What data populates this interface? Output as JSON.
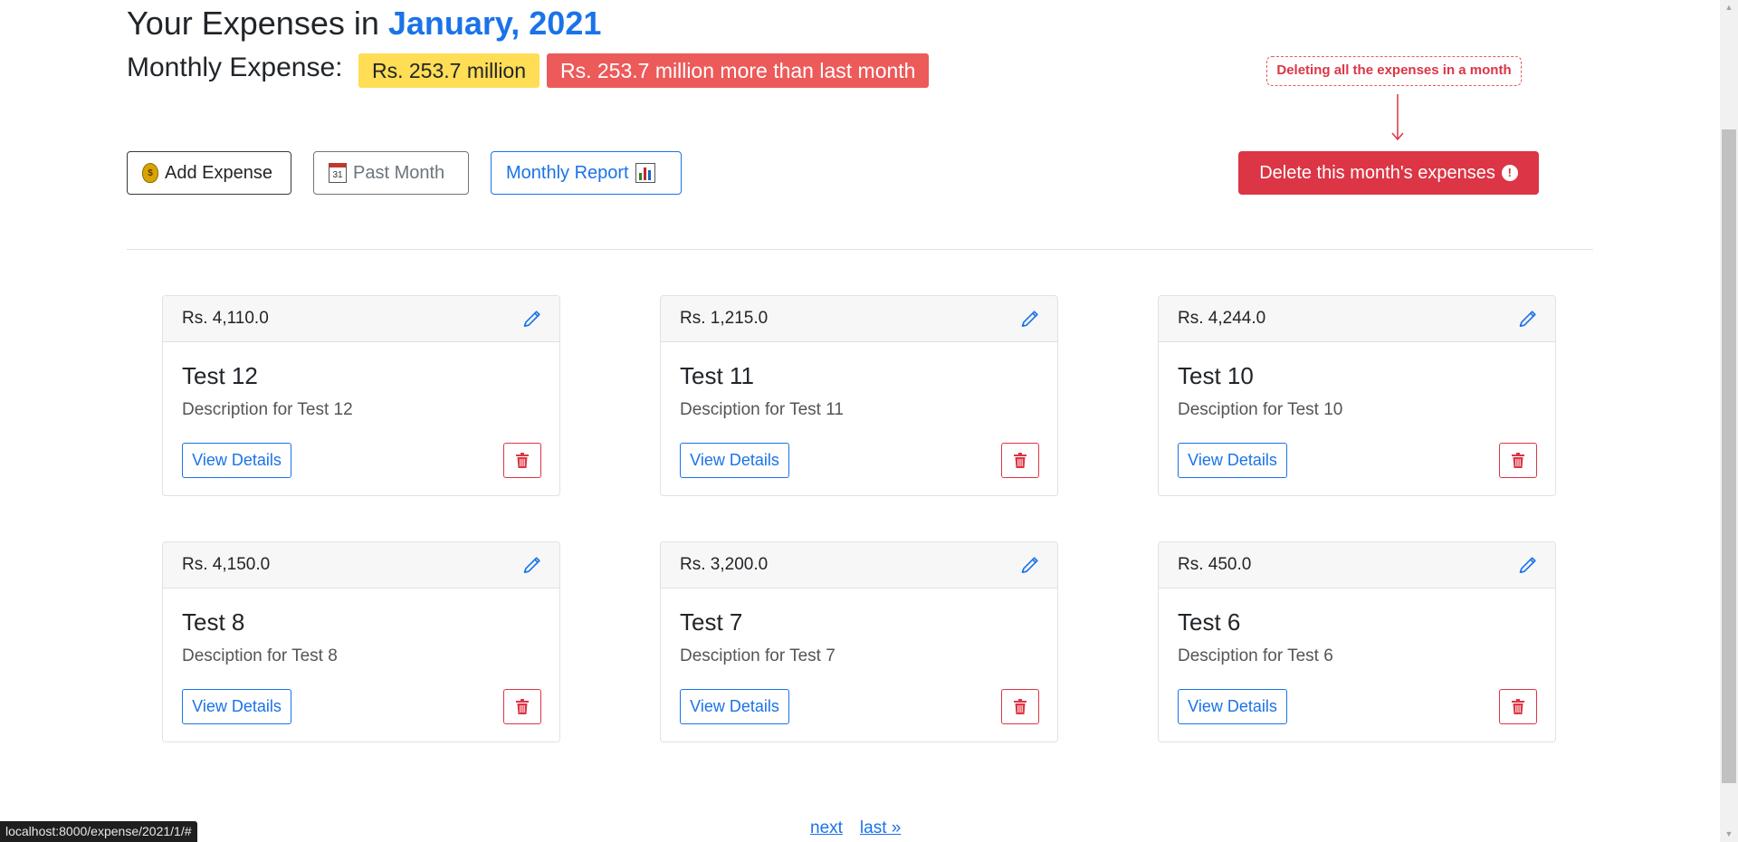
{
  "header": {
    "title_prefix": "Your Expenses in ",
    "title_month": "January, 2021",
    "expense_label": "Monthly Expense:",
    "monthly_total_badge": "Rs. 253.7 million",
    "comparison_badge": "Rs. 253.7 million more than last month"
  },
  "toolbar": {
    "add_expense_label": "Add Expense",
    "past_month_label": "Past Month",
    "calendar_icon_day": "31",
    "monthly_report_label": "Monthly Report",
    "delete_month_label": "Delete this month's expenses",
    "delete_icon_glyph": "!"
  },
  "annotation": {
    "text": "Deleting all the expenses in a month"
  },
  "expenses": [
    {
      "amount": "Rs. 4,110.0",
      "title": "Test 12",
      "description": "Description for Test 12",
      "view_label": "View Details"
    },
    {
      "amount": "Rs. 1,215.0",
      "title": "Test 11",
      "description": "Desciption for Test 11",
      "view_label": "View Details"
    },
    {
      "amount": "Rs. 4,244.0",
      "title": "Test 10",
      "description": "Desciption for Test 10",
      "view_label": "View Details"
    },
    {
      "amount": "Rs. 4,150.0",
      "title": "Test 8",
      "description": "Desciption for Test 8",
      "view_label": "View Details"
    },
    {
      "amount": "Rs. 3,200.0",
      "title": "Test 7",
      "description": "Desciption for Test 7",
      "view_label": "View Details"
    },
    {
      "amount": "Rs. 450.0",
      "title": "Test 6",
      "description": "Desciption for Test 6",
      "view_label": "View Details"
    }
  ],
  "pagination": {
    "next_label": "next",
    "last_label": "last »"
  },
  "status_bar": {
    "url": "localhost:8000/expense/2021/1/#"
  },
  "colors": {
    "accent_blue": "#1a73e8",
    "danger_red": "#dc3545",
    "badge_yellow": "#ffdd55",
    "badge_red": "#ec5a5a"
  },
  "icons": {
    "add_expense": "money-bag-icon",
    "past_month": "calendar-icon",
    "monthly_report": "bar-chart-icon",
    "delete_month": "exclamation-circle-icon",
    "card_edit": "pencil-icon",
    "card_delete": "trash-icon"
  }
}
